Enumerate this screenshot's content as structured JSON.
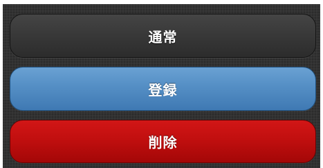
{
  "buttons": {
    "normal_label": "通常",
    "register_label": "登録",
    "delete_label": "削除"
  },
  "colors": {
    "panel_background": "#323232",
    "normal_button": "#393939",
    "register_button": "#5690c6",
    "delete_button": "#c10f0f",
    "label_text": "#ffffff"
  }
}
